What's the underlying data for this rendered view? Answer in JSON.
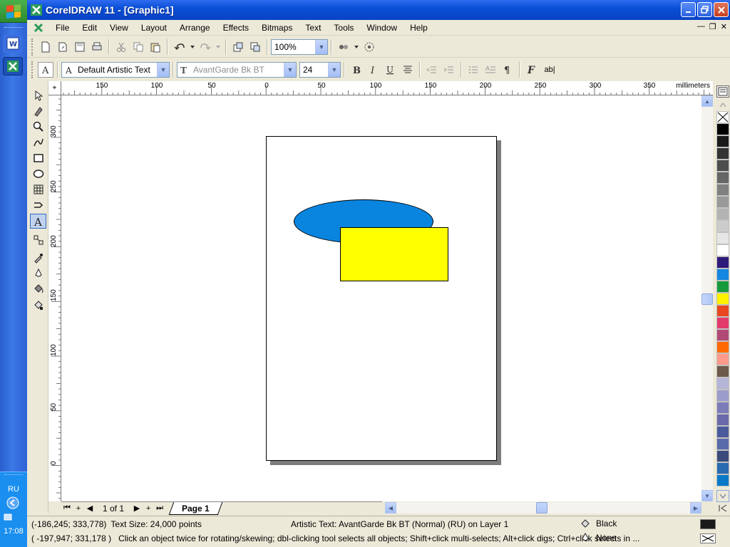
{
  "window": {
    "title": "CorelDRAW 11 - [Graphic1]"
  },
  "menu": [
    "File",
    "Edit",
    "View",
    "Layout",
    "Arrange",
    "Effects",
    "Bitmaps",
    "Text",
    "Tools",
    "Window",
    "Help"
  ],
  "toolbar": {
    "zoom": "100%"
  },
  "property_bar": {
    "text_style": "Default Artistic Text",
    "font": "AvantGarde Bk BT",
    "font_size": "24",
    "text_tool_label": "ab|"
  },
  "ruler": {
    "units": "millimeters",
    "horizontal_ticks": [
      "150",
      "100",
      "50",
      "0",
      "50",
      "100",
      "150",
      "200",
      "250",
      "300",
      "350"
    ],
    "vertical_ticks": [
      "300",
      "250",
      "200",
      "150",
      "100",
      "50",
      "0"
    ]
  },
  "page_nav": {
    "page_count": "1 of 1",
    "page_tab": "Page 1"
  },
  "status": {
    "coords_1": "(-186,245; 333,778)",
    "text_size": "Text Size: 24,000 points",
    "object_info": "Artistic Text: AvantGarde Bk BT (Normal) (RU) on Layer 1",
    "coords_2": "( -197,947; 331,178 )",
    "hint": "Click an object twice for rotating/skewing; dbl-clicking tool selects all objects; Shift+click multi-selects; Alt+click digs; Ctrl+click selects in ...",
    "fill": "Black",
    "outline": "None"
  },
  "taskbar": {
    "language": "RU",
    "clock": "17:08"
  },
  "palette": [
    "#000000",
    "#1a1a1a",
    "#333333",
    "#4d4d4d",
    "#666666",
    "#808080",
    "#999999",
    "#b3b3b3",
    "#cccccc",
    "#e6e6e6",
    "#ffffff",
    "#2e1a78",
    "#1587e0",
    "#169b3c",
    "#fff200",
    "#e8471f",
    "#e23a6b",
    "#b24a78",
    "#ff6a00",
    "#ff9a8a",
    "#6e5a4a",
    "#b5b5d8",
    "#9c9ccc",
    "#7c7cb8",
    "#6a6aaa",
    "#4a5a9a",
    "#5a6aaa",
    "#3a4a7a",
    "#2a6ab0",
    "#0a7ac8"
  ],
  "colors": {
    "ellipse": "#0a85df",
    "rectangle": "#ffff00"
  }
}
